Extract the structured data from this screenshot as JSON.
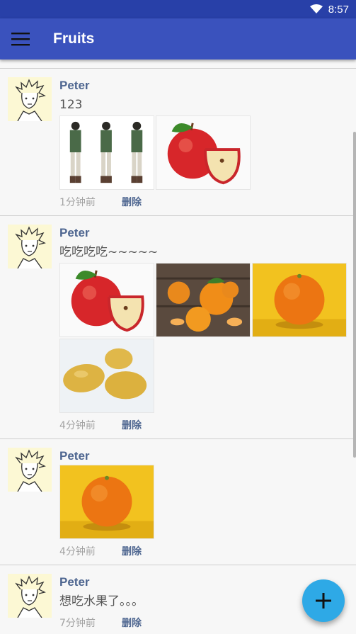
{
  "status_bar": {
    "time": "8:57",
    "wifi_icon": "wifi-icon",
    "battery_icon": "battery-icon"
  },
  "app_bar": {
    "menu_icon": "menu-icon",
    "title": "Fruits"
  },
  "posts": [
    {
      "name": "Peter",
      "text": "123",
      "time": "1分钟前",
      "delete_label": "删除",
      "images": [
        "soldier-character-sheet",
        "apple"
      ]
    },
    {
      "name": "Peter",
      "text": "吃吃吃吃~~~~~",
      "time": "4分钟前",
      "delete_label": "删除",
      "images": [
        "apple",
        "mandarin-oranges",
        "orange",
        "lemons"
      ]
    },
    {
      "name": "Peter",
      "text": "",
      "time": "4分钟前",
      "delete_label": "删除",
      "images": [
        "orange"
      ]
    },
    {
      "name": "Peter",
      "text": "想吃水果了。。。",
      "time": "7分钟前",
      "delete_label": "删除",
      "images": []
    }
  ],
  "fab": {
    "icon": "plus-icon"
  },
  "colors": {
    "status_bar": "#2840a8",
    "app_bar": "#3a52bd",
    "accent_text": "#4e6690",
    "fab": "#2ea9e6"
  }
}
